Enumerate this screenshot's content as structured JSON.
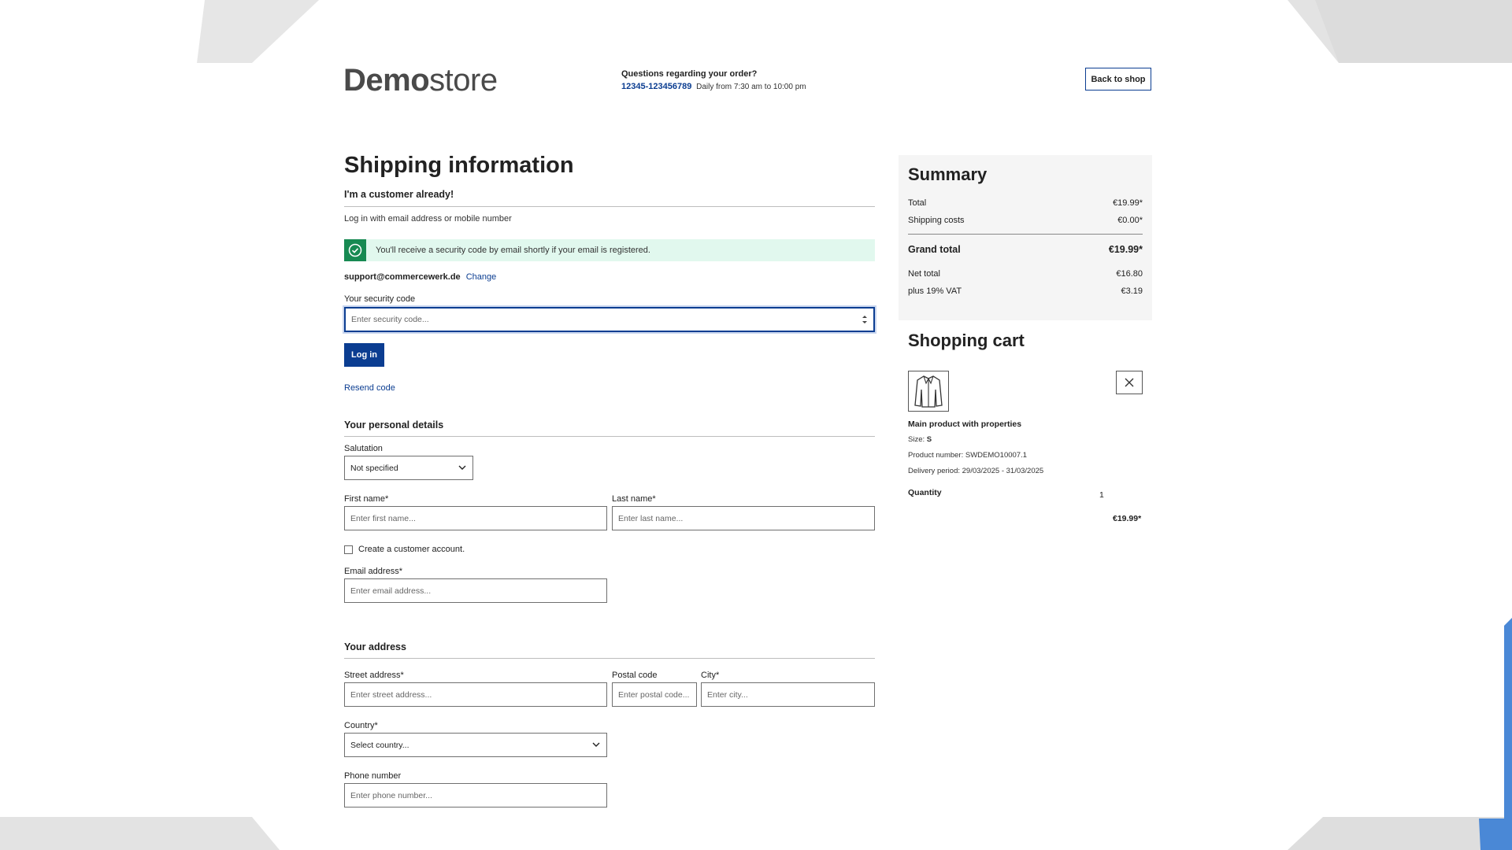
{
  "header": {
    "logo_bold": "Demo",
    "logo_light": "store",
    "help_question": "Questions regarding your order?",
    "help_phone": "12345-123456789",
    "help_hours": "Daily from 7:30 am to 10:00 pm",
    "back_button": "Back to shop"
  },
  "login": {
    "title": "Shipping information",
    "subtitle": "I'm a customer already!",
    "instruction": "Log in with email address or mobile number",
    "alert_text": "You'll receive a security code by email shortly if your email is registered.",
    "email": "support@commercewerk.de",
    "change_link": "Change",
    "code_label": "Your security code",
    "code_placeholder": "Enter security code...",
    "login_button": "Log in",
    "resend_link": "Resend code"
  },
  "personal": {
    "title": "Your personal details",
    "salutation_label": "Salutation",
    "salutation_value": "Not specified",
    "first_name_label": "First name*",
    "first_name_placeholder": "Enter first name...",
    "last_name_label": "Last name*",
    "last_name_placeholder": "Enter last name...",
    "create_account_label": "Create a customer account.",
    "email_label": "Email address*",
    "email_placeholder": "Enter email address..."
  },
  "address": {
    "title": "Your address",
    "street_label": "Street address*",
    "street_placeholder": "Enter street address...",
    "postal_label": "Postal code",
    "postal_placeholder": "Enter postal code...",
    "city_label": "City*",
    "city_placeholder": "Enter city...",
    "country_label": "Country*",
    "country_value": "Select country...",
    "phone_label": "Phone number",
    "phone_placeholder": "Enter phone number..."
  },
  "summary": {
    "title": "Summary",
    "total_label": "Total",
    "total_value": "€19.99*",
    "shipping_label": "Shipping costs",
    "shipping_value": "€0.00*",
    "grand_label": "Grand total",
    "grand_value": "€19.99*",
    "net_label": "Net total",
    "net_value": "€16.80",
    "vat_label": "plus 19% VAT",
    "vat_value": "€3.19"
  },
  "cart": {
    "title": "Shopping cart",
    "product_name": "Main product with properties",
    "size_label": "Size:",
    "size_value": "S",
    "product_number": "Product number: SWDEMO10007.1",
    "delivery": "Delivery period: 29/03/2025 - 31/03/2025",
    "quantity_label": "Quantity",
    "quantity_value": "1",
    "price": "€19.99*"
  },
  "colors": {
    "accent": "#0b3d91",
    "success": "#178a52",
    "success_bg": "#e1f8ee"
  }
}
